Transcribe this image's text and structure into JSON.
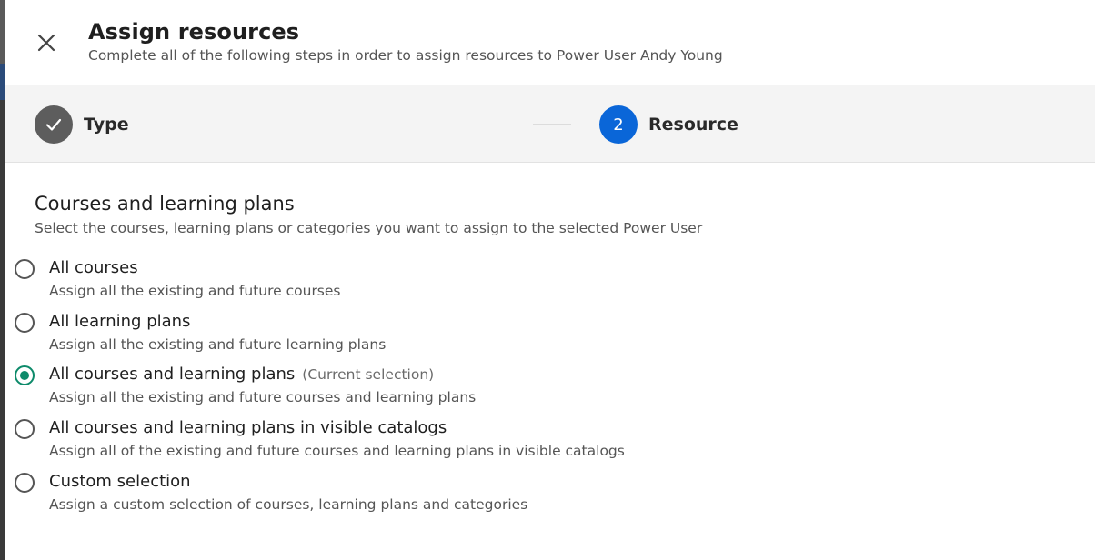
{
  "header": {
    "title": "Assign resources",
    "subtitle": "Complete all of the following steps in order to assign resources to Power User Andy Young",
    "close_icon": "close-icon"
  },
  "stepper": {
    "steps": [
      {
        "label": "Type",
        "status": "done",
        "icon": "check-icon"
      },
      {
        "label": "Resource",
        "status": "active",
        "number": "2"
      }
    ]
  },
  "section": {
    "title": "Courses and learning plans",
    "description": "Select the courses, learning plans or categories you want to assign to the selected Power User"
  },
  "options": [
    {
      "label": "All courses",
      "description": "Assign all the existing and future courses",
      "selected": false,
      "note": ""
    },
    {
      "label": "All learning plans",
      "description": "Assign all the existing and future learning plans",
      "selected": false,
      "note": ""
    },
    {
      "label": "All courses and learning plans",
      "description": "Assign all the existing and future courses and learning plans",
      "selected": true,
      "note": "(Current selection)"
    },
    {
      "label": "All courses and learning plans in visible catalogs",
      "description": "Assign all of the existing and future courses and learning plans in visible catalogs",
      "selected": false,
      "note": ""
    },
    {
      "label": "Custom selection",
      "description": "Assign a custom selection of courses, learning plans and categories",
      "selected": false,
      "note": ""
    }
  ],
  "colors": {
    "active_step": "#0a66d8",
    "done_step": "#5d5d5d",
    "radio_selected": "#0d8a6a"
  }
}
